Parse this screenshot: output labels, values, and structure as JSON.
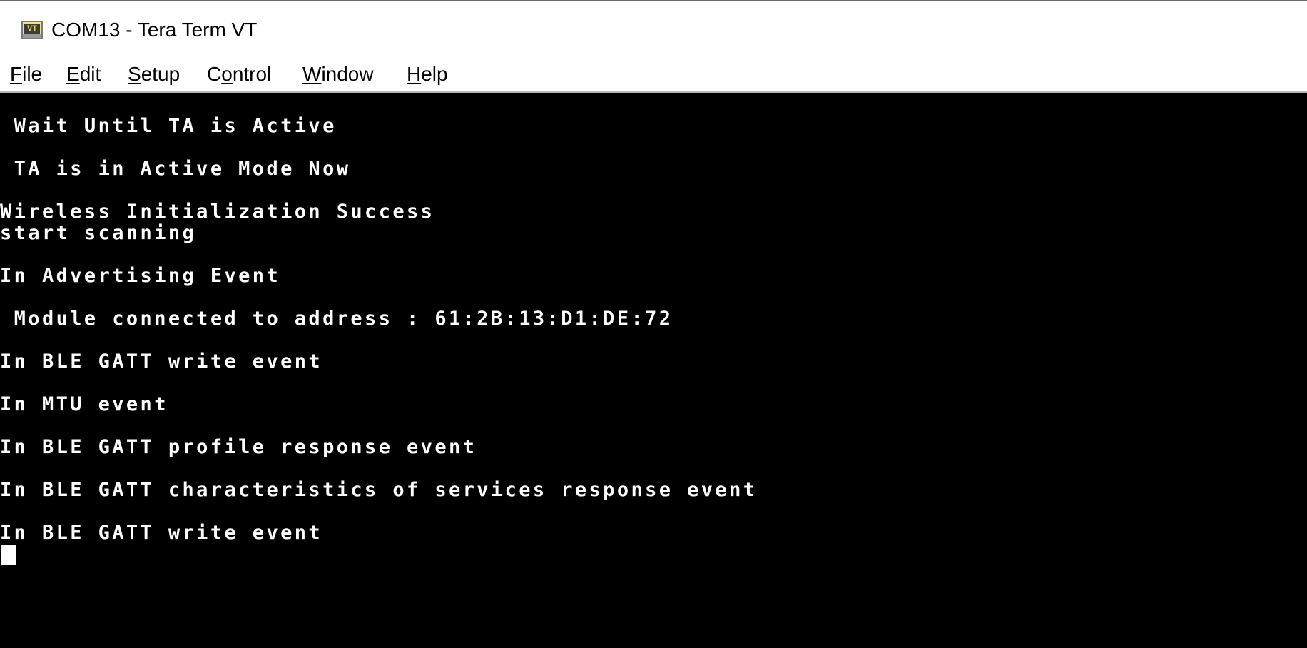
{
  "window": {
    "title": "COM13 - Tera Term VT",
    "icon": "vt-terminal-icon",
    "icon_label": "VT"
  },
  "menu": [
    {
      "accel": "F",
      "rest": "ile"
    },
    {
      "accel": "E",
      "rest": "dit"
    },
    {
      "accel": "S",
      "rest": "etup"
    },
    {
      "pre": "C",
      "accel": "o",
      "rest": "ntrol"
    },
    {
      "accel": "W",
      "rest": "indow"
    },
    {
      "accel": "H",
      "rest": "elp"
    }
  ],
  "terminal": {
    "background": "#000000",
    "foreground": "#ffffff",
    "lines": [
      " Wait Until TA is Active",
      " TA is in Active Mode Now",
      "Wireless Initialization Success",
      "start scanning",
      "In Advertising Event",
      " Module connected to address : 61:2B:13:D1:DE:72",
      "In BLE GATT write event",
      "In MTU event",
      "In BLE GATT profile response event",
      "In BLE GATT characteristics of services response event",
      "In BLE GATT write event"
    ]
  }
}
